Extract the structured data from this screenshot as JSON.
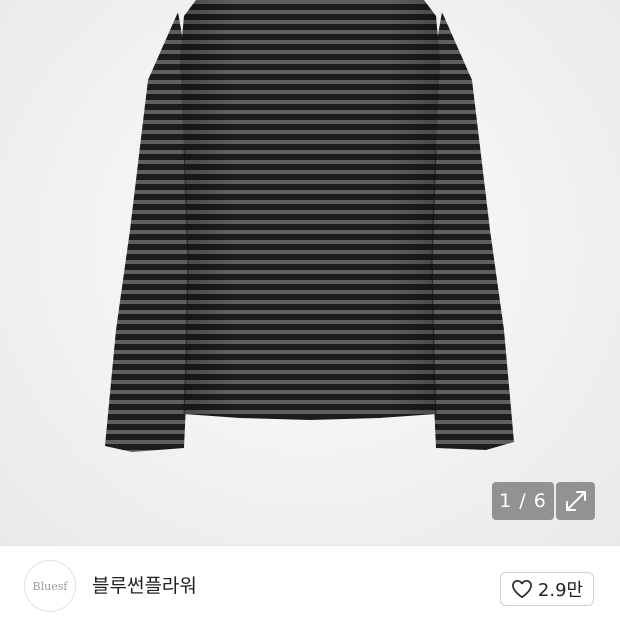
{
  "gallery": {
    "page_counter": "1 / 6",
    "expand_icon": "expand-arrows-icon",
    "image": "striped-long-sleeve-shirt"
  },
  "seller": {
    "avatar_text": "Bluesf",
    "name": "블루썬플라워"
  },
  "like": {
    "icon": "heart-outline-icon",
    "count": "2.9만"
  },
  "colors": {
    "stripe_dark": "#1c1c1c",
    "stripe_light": "#5f5f5f",
    "badge_bg": "#7a7a7a"
  }
}
